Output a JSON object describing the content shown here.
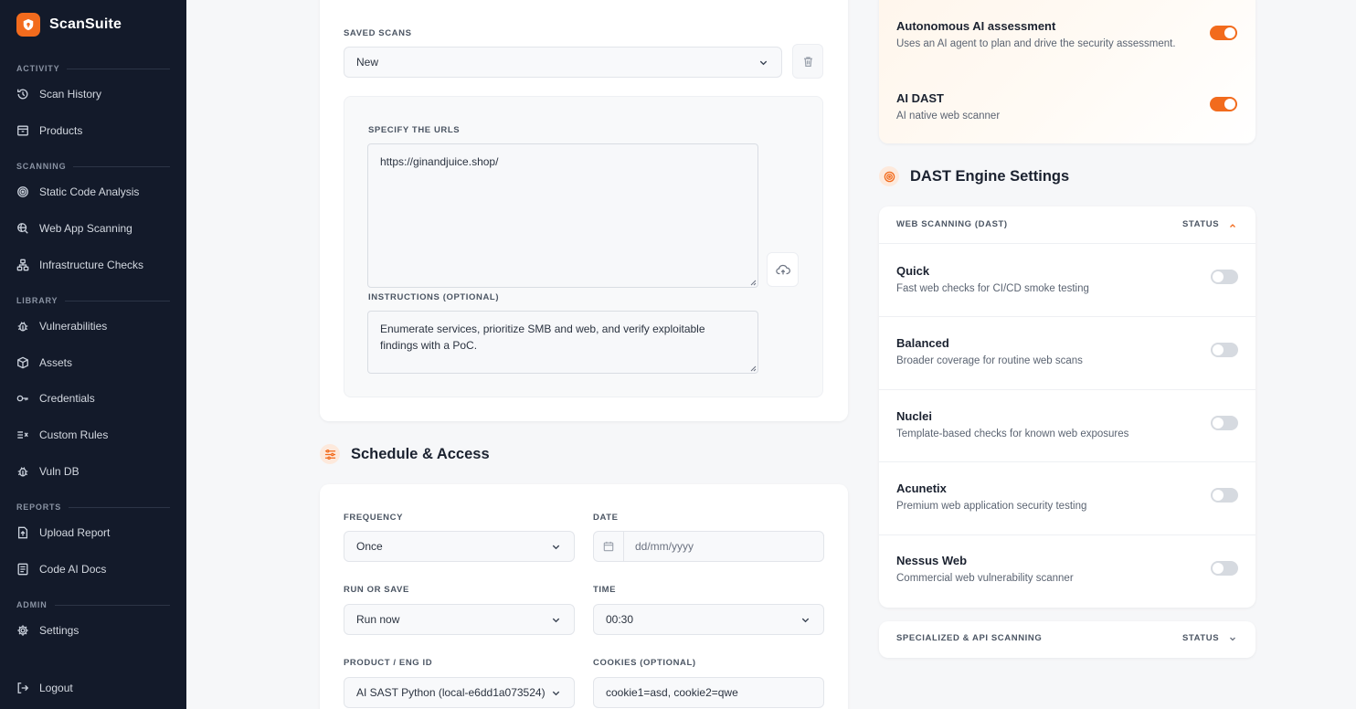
{
  "brand": {
    "name": "ScanSuite",
    "accent": "#f26b1d"
  },
  "sidebar": {
    "sections": [
      {
        "label": "ACTIVITY"
      },
      {
        "label": "SCANNING"
      },
      {
        "label": "LIBRARY"
      },
      {
        "label": "REPORTS"
      },
      {
        "label": "ADMIN"
      }
    ],
    "items": [
      {
        "label": "Scan History",
        "icon": "history-icon"
      },
      {
        "label": "Products",
        "icon": "archive-icon"
      },
      {
        "label": "Static Code Analysis",
        "icon": "target-icon"
      },
      {
        "label": "Web App Scanning",
        "icon": "globe-search-icon"
      },
      {
        "label": "Infrastructure Checks",
        "icon": "network-icon"
      },
      {
        "label": "Vulnerabilities",
        "icon": "bug-icon"
      },
      {
        "label": "Assets",
        "icon": "cube-icon"
      },
      {
        "label": "Credentials",
        "icon": "key-icon"
      },
      {
        "label": "Custom Rules",
        "icon": "rules-icon"
      },
      {
        "label": "Vuln DB",
        "icon": "bug-icon"
      },
      {
        "label": "Upload Report",
        "icon": "upload-file-icon"
      },
      {
        "label": "Code AI Docs",
        "icon": "document-icon"
      },
      {
        "label": "Settings",
        "icon": "gear-icon"
      }
    ],
    "logout": {
      "label": "Logout",
      "icon": "logout-icon"
    }
  },
  "saved_scans": {
    "label": "SAVED SCANS",
    "selected": "New"
  },
  "urls": {
    "label": "SPECIFY THE URLS",
    "value": "https://ginandjuice.shop/"
  },
  "instructions": {
    "label": "INSTRUCTIONS (OPTIONAL)",
    "value": "Enumerate services, prioritize SMB and web, and verify exploitable findings with a PoC."
  },
  "schedule": {
    "title": "Schedule & Access",
    "frequency": {
      "label": "FREQUENCY",
      "value": "Once"
    },
    "date": {
      "label": "DATE",
      "placeholder": "dd/mm/yyyy"
    },
    "run_or_save": {
      "label": "RUN OR SAVE",
      "value": "Run now"
    },
    "time": {
      "label": "TIME",
      "value": "00:30"
    },
    "product": {
      "label": "PRODUCT / ENG ID",
      "value": "AI SAST Python (local-e6dd1a073524)"
    },
    "cookies": {
      "label": "COOKIES (OPTIONAL)",
      "value": "cookie1=asd, cookie2=qwe"
    }
  },
  "ai_options": [
    {
      "name": "Autonomous AI assessment",
      "desc": "Uses an AI agent to plan and drive the security assessment.",
      "enabled": true
    },
    {
      "name": "AI DAST",
      "desc": "AI native web scanner",
      "enabled": true
    }
  ],
  "dast": {
    "title": "DAST Engine Settings",
    "web_header": "WEB SCANNING (DAST)",
    "status_label": "STATUS",
    "engines": [
      {
        "name": "Quick",
        "desc": "Fast web checks for CI/CD smoke testing",
        "enabled": false
      },
      {
        "name": "Balanced",
        "desc": "Broader coverage for routine web scans",
        "enabled": false
      },
      {
        "name": "Nuclei",
        "desc": "Template-based checks for known web exposures",
        "enabled": false
      },
      {
        "name": "Acunetix",
        "desc": "Premium web application security testing",
        "enabled": false
      },
      {
        "name": "Nessus Web",
        "desc": "Commercial web vulnerability scanner",
        "enabled": false
      }
    ],
    "specialized_header": "SPECIALIZED & API SCANNING"
  }
}
